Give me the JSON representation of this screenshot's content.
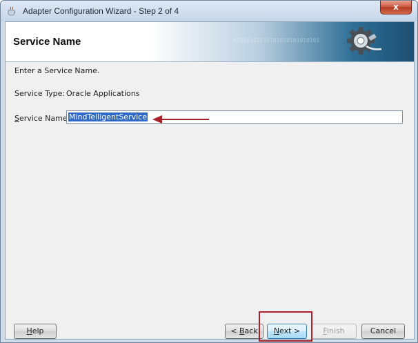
{
  "window": {
    "title": "Adapter Configuration Wizard - Step 2 of 4",
    "close_label": "x"
  },
  "header": {
    "title": "Service Name",
    "binary_text": "01010101010101010101010101"
  },
  "form": {
    "instruction": "Enter a Service Name.",
    "service_type_label": "Service Type:",
    "service_type_value": "Oracle Applications",
    "service_name_label_pre": "",
    "service_name_label_mnemonic": "S",
    "service_name_label_post": "ervice Name:",
    "service_name_value": "MindTelligentService"
  },
  "buttons": {
    "help": {
      "mnemonic": "H",
      "rest": "elp"
    },
    "back": {
      "pre": "< ",
      "mnemonic": "B",
      "rest": "ack"
    },
    "next": {
      "mnemonic": "N",
      "rest": "ext >"
    },
    "finish": {
      "mnemonic": "F",
      "rest": "inish"
    },
    "cancel": {
      "label": "Cancel"
    }
  },
  "colors": {
    "annotation": "#a8212a",
    "selection": "#3169c6"
  }
}
